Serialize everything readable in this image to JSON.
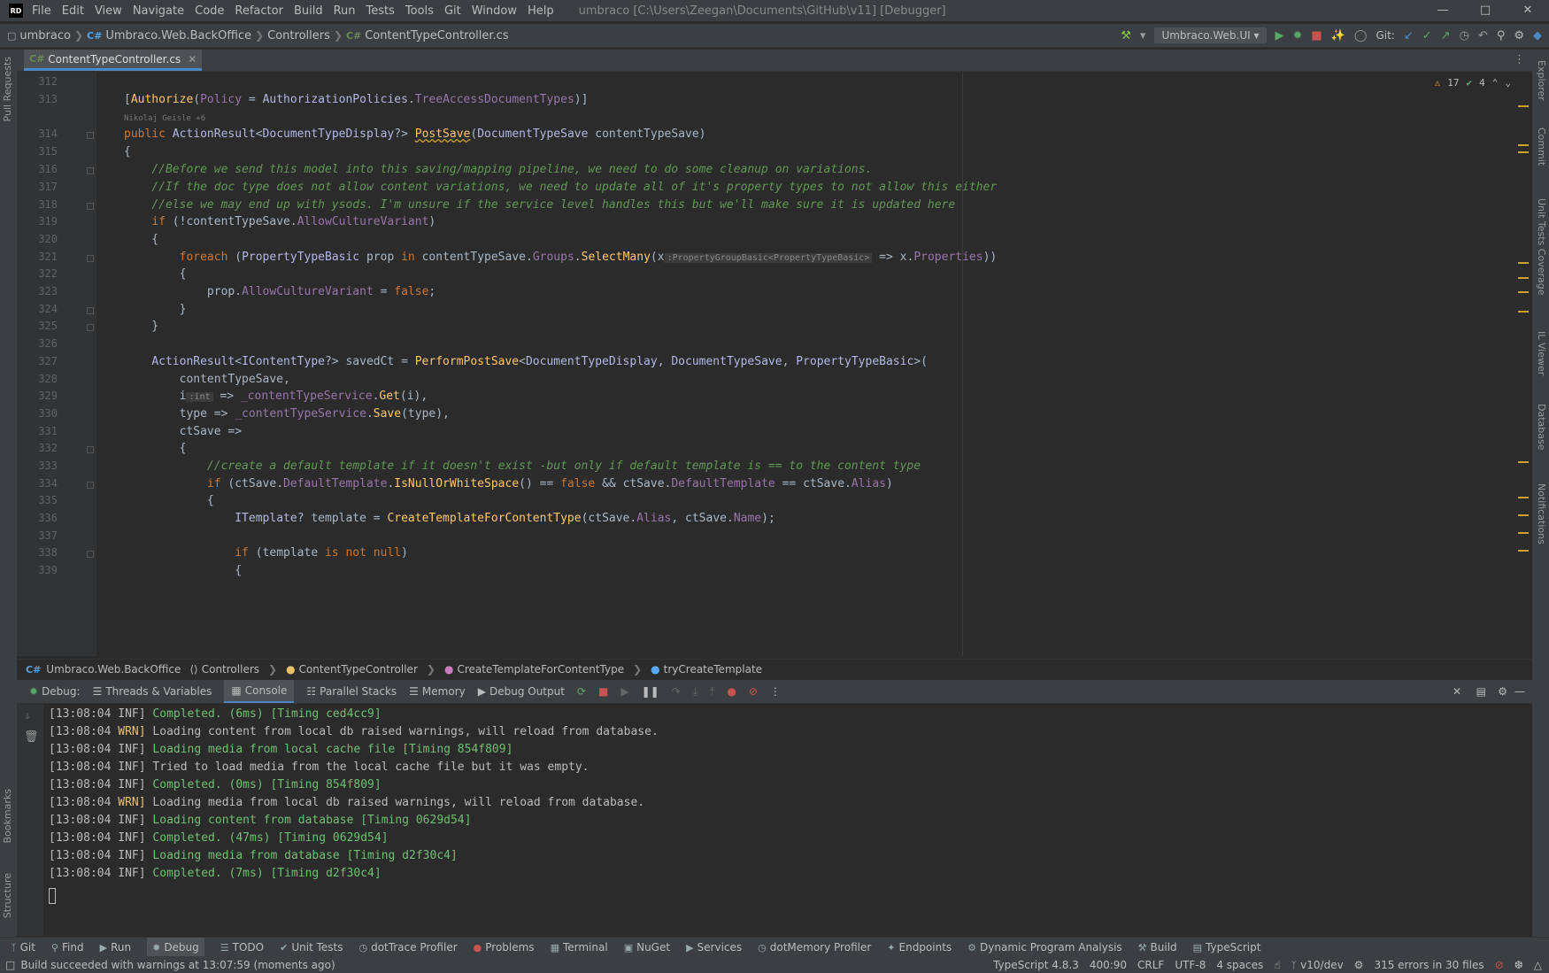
{
  "menu": {
    "logo": "RD",
    "items": [
      "File",
      "Edit",
      "View",
      "Navigate",
      "Code",
      "Refactor",
      "Build",
      "Run",
      "Tests",
      "Tools",
      "Git",
      "Window",
      "Help"
    ],
    "window_title": "umbraco [C:\\Users\\Zeegan\\Documents\\GitHub\\v11] [Debugger]"
  },
  "navbar": {
    "crumbs": [
      "umbraco",
      "Umbraco.Web.BackOffice",
      "Controllers",
      "ContentTypeController.cs"
    ],
    "run_config": "Umbraco.Web.UI",
    "git_label": "Git:"
  },
  "tab": {
    "label": "ContentTypeController.cs",
    "lang": "C#"
  },
  "inspections": {
    "warnings": "17",
    "ok": "4"
  },
  "author_hint": "Nikolaj Geisle +6",
  "line_numbers": [
    "312",
    "313",
    "314",
    "315",
    "316",
    "317",
    "318",
    "319",
    "320",
    "321",
    "322",
    "323",
    "324",
    "325",
    "326",
    "327",
    "328",
    "329",
    "330",
    "331",
    "332",
    "333",
    "334",
    "335",
    "336",
    "337",
    "338",
    "339"
  ],
  "editor_crumbs": [
    "Umbraco.Web.BackOffice",
    "Controllers",
    "ContentTypeController",
    "CreateTemplateForContentType",
    "tryCreateTemplate"
  ],
  "debug": {
    "label": "Debug:",
    "tabs": [
      "Threads & Variables",
      "Console",
      "Parallel Stacks",
      "Memory",
      "Debug Output"
    ]
  },
  "console": [
    {
      "time": "[13:08:04",
      "level": "INF]",
      "msg": "Completed. (6ms) [Timing ced4cc9]",
      "color": "green"
    },
    {
      "time": "[13:08:04",
      "level": "WRN]",
      "msg": "Loading content from local db raised warnings, will reload from database.",
      "color": "white"
    },
    {
      "time": "[13:08:04",
      "level": "INF]",
      "msg": "Loading media from local cache file [Timing 854f809]",
      "color": "green"
    },
    {
      "time": "[13:08:04",
      "level": "INF]",
      "msg": "Tried to load media from the local cache file but it was empty.",
      "color": "white"
    },
    {
      "time": "[13:08:04",
      "level": "INF]",
      "msg": "Completed. (0ms) [Timing 854f809]",
      "color": "green"
    },
    {
      "time": "[13:08:04",
      "level": "WRN]",
      "msg": "Loading media from local db raised warnings, will reload from database.",
      "color": "white"
    },
    {
      "time": "[13:08:04",
      "level": "INF]",
      "msg": "Loading content from database [Timing 0629d54]",
      "color": "green"
    },
    {
      "time": "[13:08:04",
      "level": "INF]",
      "msg": "Completed. (47ms) [Timing 0629d54]",
      "color": "green"
    },
    {
      "time": "[13:08:04",
      "level": "INF]",
      "msg": "Loading media from database [Timing d2f30c4]",
      "color": "green"
    },
    {
      "time": "[13:08:04",
      "level": "INF]",
      "msg": "Completed. (7ms) [Timing d2f30c4]",
      "color": "green"
    }
  ],
  "bottom_tools": [
    "Git",
    "Find",
    "Run",
    "Debug",
    "TODO",
    "Unit Tests",
    "dotTrace Profiler",
    "Problems",
    "Terminal",
    "NuGet",
    "Services",
    "dotMemory Profiler",
    "Endpoints",
    "Dynamic Program Analysis",
    "Build",
    "TypeScript"
  ],
  "left_strip": [
    "Pull Requests",
    "Bookmarks",
    "Structure"
  ],
  "right_strip": [
    "Explorer",
    "Commit",
    "Unit Tests Coverage",
    "IL Viewer",
    "Database",
    "Notifications"
  ],
  "status": {
    "message": "Build succeeded with warnings at 13:07:59 (moments ago)",
    "typescript": "TypeScript 4.8.3",
    "position": "400:90",
    "line_ending": "CRLF",
    "encoding": "UTF-8",
    "indent": "4 spaces",
    "branch": "v10/dev",
    "errors": "315 errors in 30 files"
  }
}
